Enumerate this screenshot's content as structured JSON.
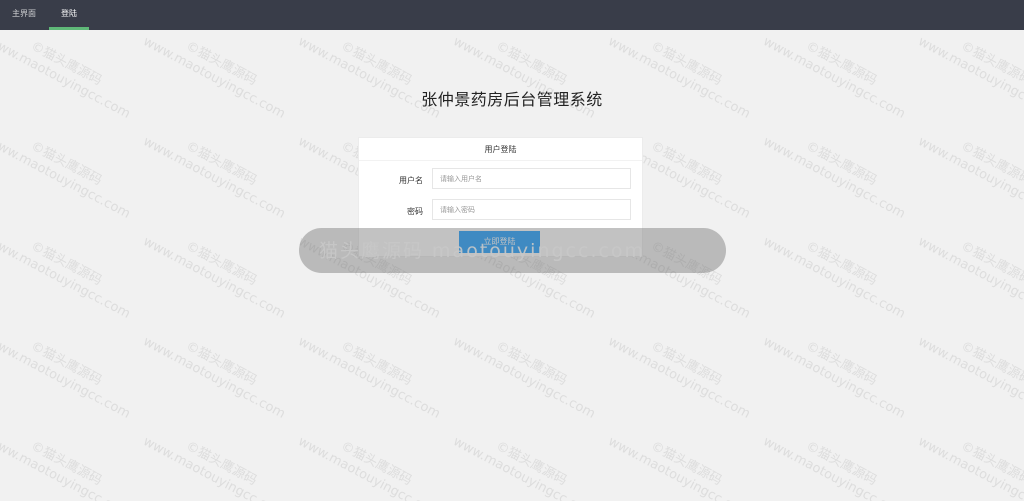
{
  "nav": {
    "items": [
      {
        "label": "主界面",
        "active": false
      },
      {
        "label": "登陆",
        "active": true
      }
    ]
  },
  "page": {
    "title": "张仲景药房后台管理系统"
  },
  "login": {
    "card_title": "用户登陆",
    "username_label": "用户名",
    "username_placeholder": "请输入用户名",
    "password_label": "密码",
    "password_placeholder": "请输入密码",
    "submit_label": "立即登陆"
  },
  "watermark": {
    "brand": "©猫头鹰源码",
    "site": "www.maotouyingcc.com"
  },
  "banner": {
    "text": "猫头鹰源码 maotouyingcc.com"
  },
  "colors": {
    "topbar": "#393d49",
    "accent_underline": "#5fb878",
    "button": "#1e9fff",
    "background": "#f1f1f1"
  }
}
